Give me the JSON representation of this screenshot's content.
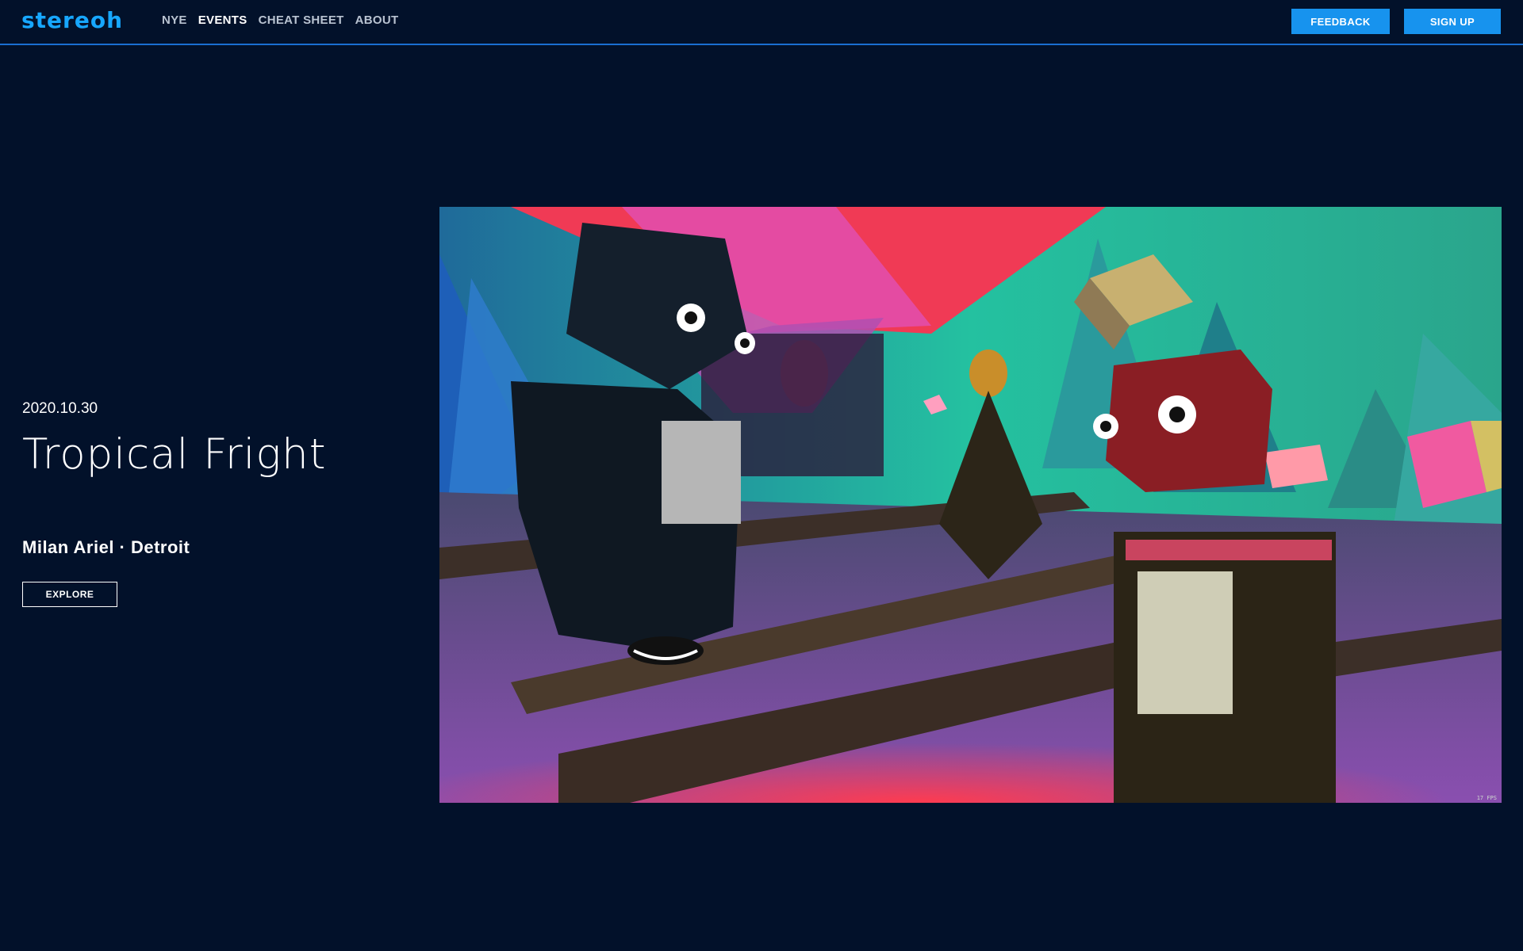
{
  "header": {
    "logo_text": "stereoh",
    "nav": [
      {
        "label": "NYE",
        "active": false
      },
      {
        "label": "EVENTS",
        "active": true
      },
      {
        "label": "CHEAT SHEET",
        "active": false
      },
      {
        "label": "ABOUT",
        "active": false
      }
    ],
    "feedback_label": "FEEDBACK",
    "signup_label": "SIGN UP"
  },
  "event": {
    "date": "2020.10.30",
    "title": "Tropical Fright",
    "subtitle": "Milan Ariel · Detroit",
    "explore_label": "EXPLORE"
  },
  "scene": {
    "fps_label": "17 FPS"
  },
  "colors": {
    "background": "#02112a",
    "accent": "#1793ee",
    "logo": "#17a7ff",
    "divider": "#1a6fd1"
  }
}
